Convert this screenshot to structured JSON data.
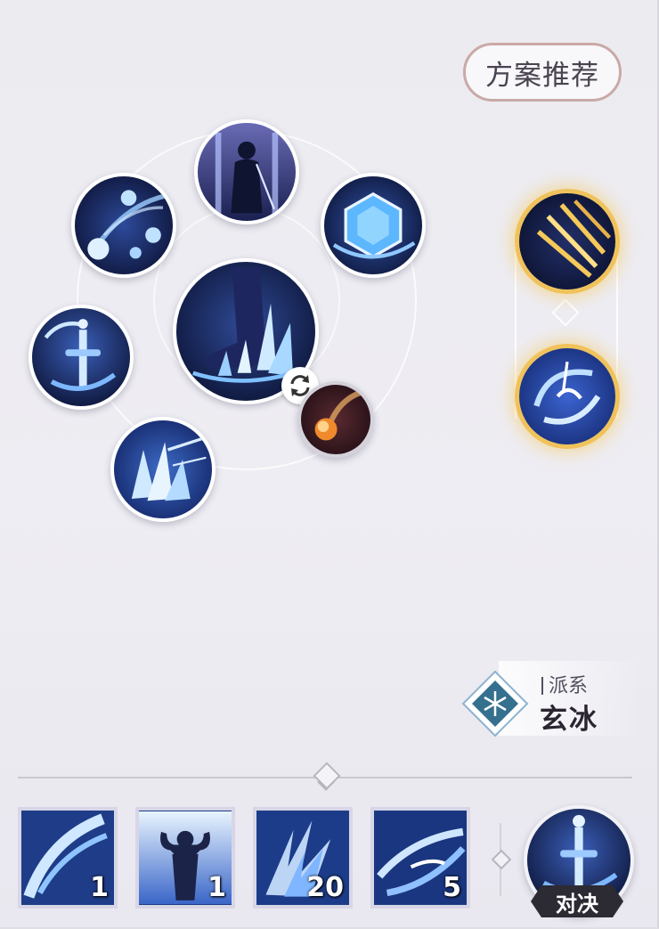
{
  "header": {
    "recommend_label": "方案推荐"
  },
  "skill_wheel": {
    "center_skill": "ice-stomp-icon",
    "orbit_skills": [
      "triple-orb-icon",
      "swordsman-portrait-icon",
      "ice-crystal-icon",
      "ice-sword-icon",
      "ice-shards-icon"
    ],
    "attached_skill": "meteor-icon",
    "swap_icon": "swap-arrows-icon"
  },
  "side_skills": [
    "golden-blades-icon",
    "frost-vortex-icon"
  ],
  "faction": {
    "label": "派系",
    "name": "玄冰",
    "icon": "snowflake-icon"
  },
  "bottom_bar": {
    "tiles": [
      {
        "icon": "ice-slash-icon",
        "count": "1"
      },
      {
        "icon": "strongman-icon",
        "count": "1"
      },
      {
        "icon": "ice-spikes-icon",
        "count": "20"
      },
      {
        "icon": "whirlwind-icon",
        "count": "5"
      }
    ],
    "duel": {
      "icon": "ice-sword-icon",
      "label": "对决"
    }
  },
  "colors": {
    "accent_border": "#c9aaa6",
    "gold": "#f0c25a",
    "ice_blue": "#5aa8f0",
    "dark_navy": "#1a2350"
  }
}
